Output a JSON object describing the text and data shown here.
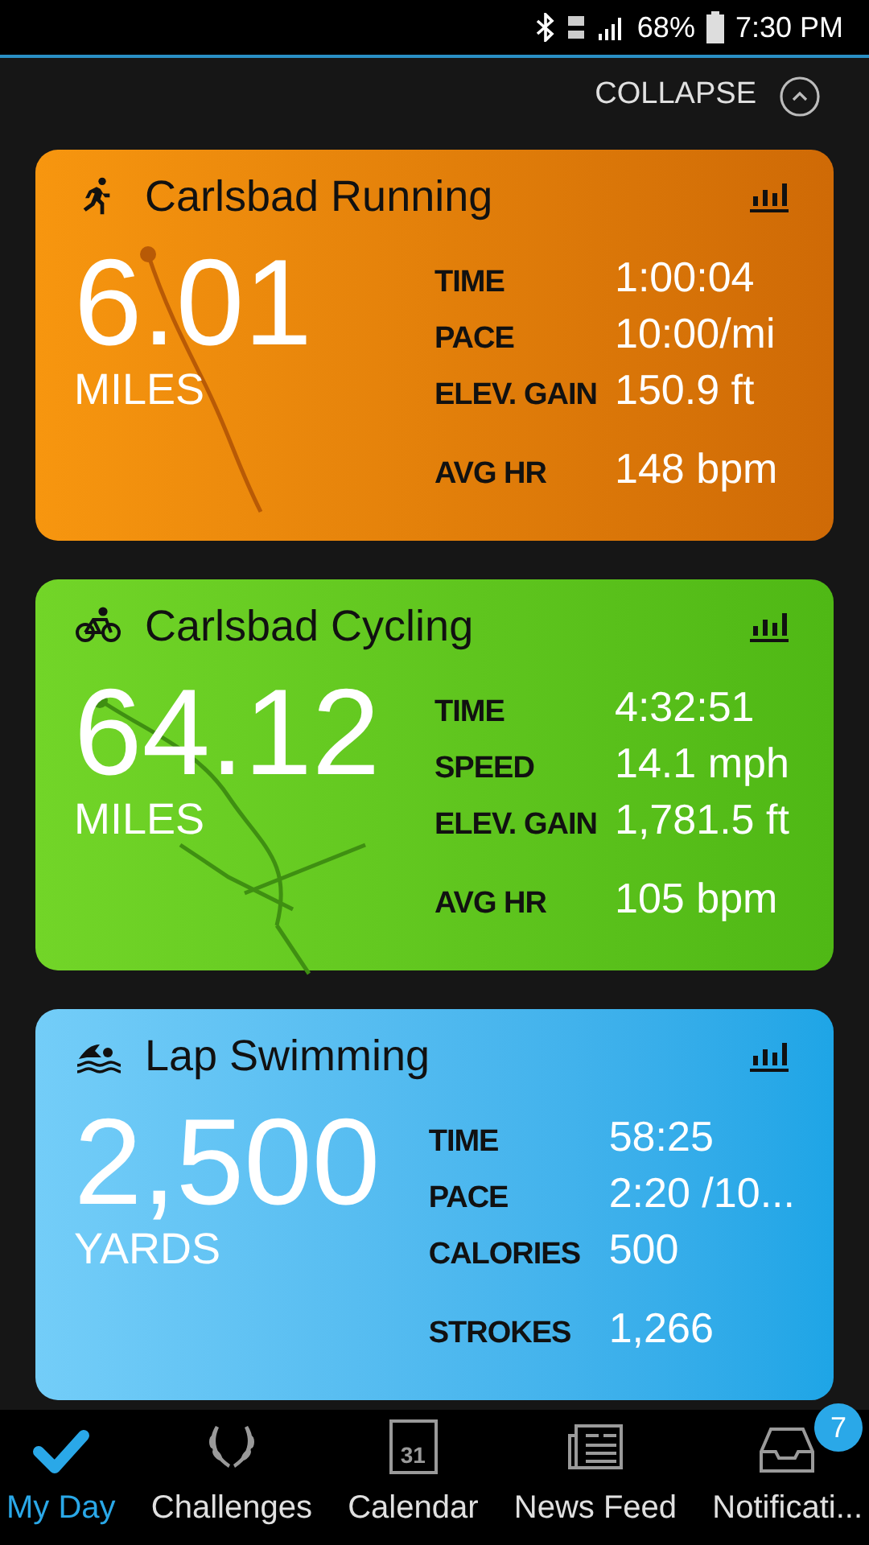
{
  "status_bar": {
    "battery": "68%",
    "time": "7:30 PM"
  },
  "collapse": {
    "label": "COLLAPSE"
  },
  "activities": [
    {
      "kind": "run",
      "title": "Carlsbad Running",
      "distance": "6.01",
      "unit": "MILES",
      "stats": [
        {
          "label": "TIME",
          "value": "1:00:04"
        },
        {
          "label": "PACE",
          "value": "10:00/mi"
        },
        {
          "label": "ELEV. GAIN",
          "value": "150.9 ft"
        },
        {
          "label": "AVG HR",
          "value": "148 bpm"
        }
      ]
    },
    {
      "kind": "bike",
      "title": "Carlsbad Cycling",
      "distance": "64.12",
      "unit": "MILES",
      "stats": [
        {
          "label": "TIME",
          "value": "4:32:51"
        },
        {
          "label": "SPEED",
          "value": "14.1 mph"
        },
        {
          "label": "ELEV. GAIN",
          "value": "1,781.5 ft"
        },
        {
          "label": "AVG HR",
          "value": "105 bpm"
        }
      ]
    },
    {
      "kind": "swim",
      "title": "Lap Swimming",
      "distance": "2,500",
      "unit": "YARDS",
      "stats": [
        {
          "label": "TIME",
          "value": "58:25"
        },
        {
          "label": "PACE",
          "value": "2:20 /10..."
        },
        {
          "label": "CALORIES",
          "value": "500"
        },
        {
          "label": "STROKES",
          "value": "1,266"
        }
      ]
    }
  ],
  "nav": [
    {
      "kind": "check",
      "label": "My Day",
      "selected": true
    },
    {
      "kind": "laurel",
      "label": "Challenges",
      "selected": false
    },
    {
      "kind": "calendar",
      "label": "Calendar",
      "selected": false,
      "icon_text": "31"
    },
    {
      "kind": "news",
      "label": "News Feed",
      "selected": false
    },
    {
      "kind": "inbox",
      "label": "Notificati...",
      "selected": false,
      "badge": "7"
    }
  ]
}
